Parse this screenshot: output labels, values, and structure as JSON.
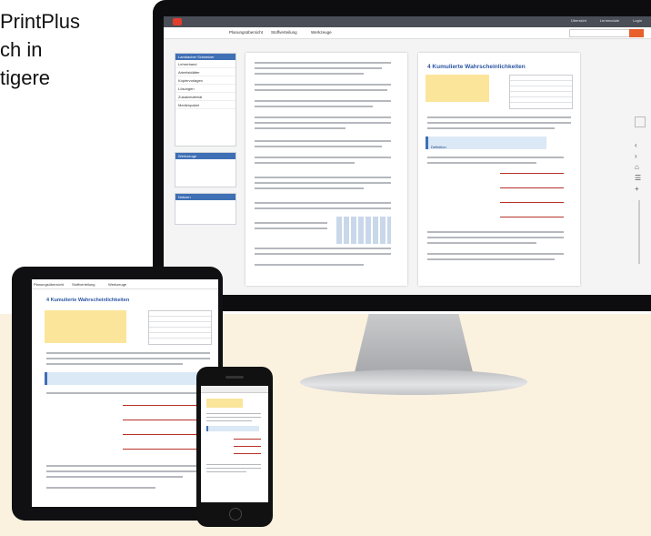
{
  "headline": {
    "lines": [
      "PrintPlus",
      "ch in",
      "tigere"
    ]
  },
  "desktop": {
    "nav": {
      "tabs": [
        "Planungsübersicht",
        "Stoffverteilung",
        "Werkzeuge"
      ]
    },
    "top_right": [
      "Übersicht",
      "Lernmodule",
      "Login"
    ],
    "sidebar": {
      "header": "Lambacher Schweizer",
      "items": [
        "Lehrerband",
        "Arbeitsblätter",
        "Kopiervorlagen",
        "Lösungen",
        "Zusatzmaterial",
        "Medienpaket"
      ],
      "tools_header": "Werkzeuge",
      "notes_header": "Notizen"
    },
    "page_right": {
      "title": "4  Kumulierte Wahrscheinlichkeiten",
      "definition_label": "Definition"
    }
  },
  "tablet": {
    "nav": {
      "tabs": [
        "Planungsübersicht",
        "Stoffverteilung",
        "Werkzeuge"
      ]
    },
    "page": {
      "title": "4  Kumulierte Wahrscheinlichkeiten"
    }
  },
  "colors": {
    "accent_blue": "#3f6fb5",
    "accent_orange": "#e8602c",
    "highlight_yellow": "#fbe59a",
    "cream_background": "#fbf1df"
  }
}
